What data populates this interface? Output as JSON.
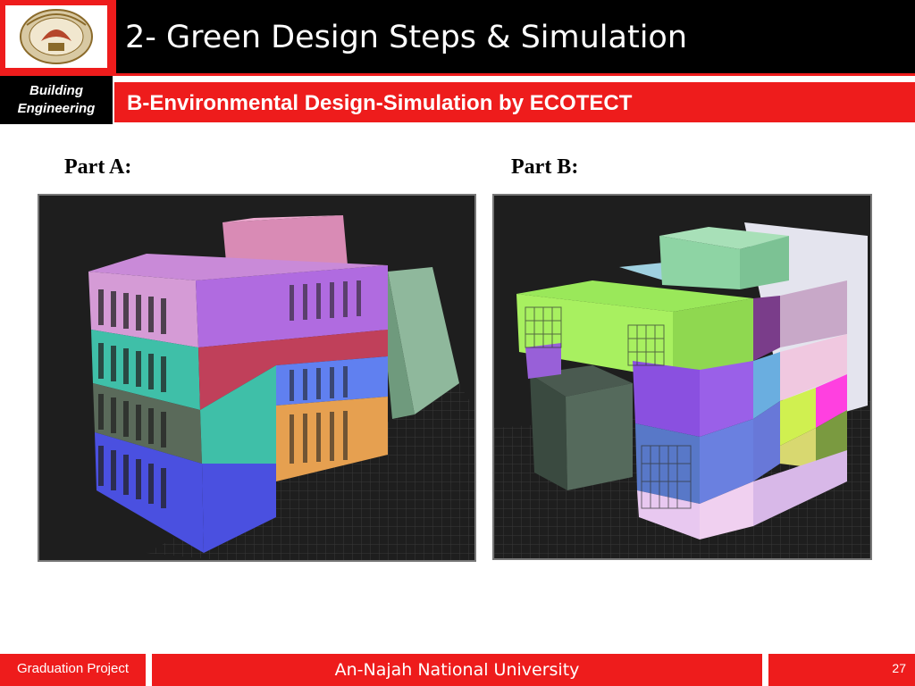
{
  "header": {
    "title": "2- Green Design Steps & Simulation",
    "logo_icon": "university-seal-logo"
  },
  "subheader": {
    "department_line1": "Building",
    "department_line2": "Engineering",
    "subtitle": "B-Environmental Design-Simulation by ECOTECT"
  },
  "content": {
    "part_a_label": "Part A:",
    "part_b_label": "Part B:"
  },
  "footer": {
    "left_text": "Graduation Project",
    "center_text": "An-Najah National University",
    "page_number": "27"
  },
  "colors": {
    "accent_red": "#ee1c1c",
    "header_black": "#000000"
  }
}
